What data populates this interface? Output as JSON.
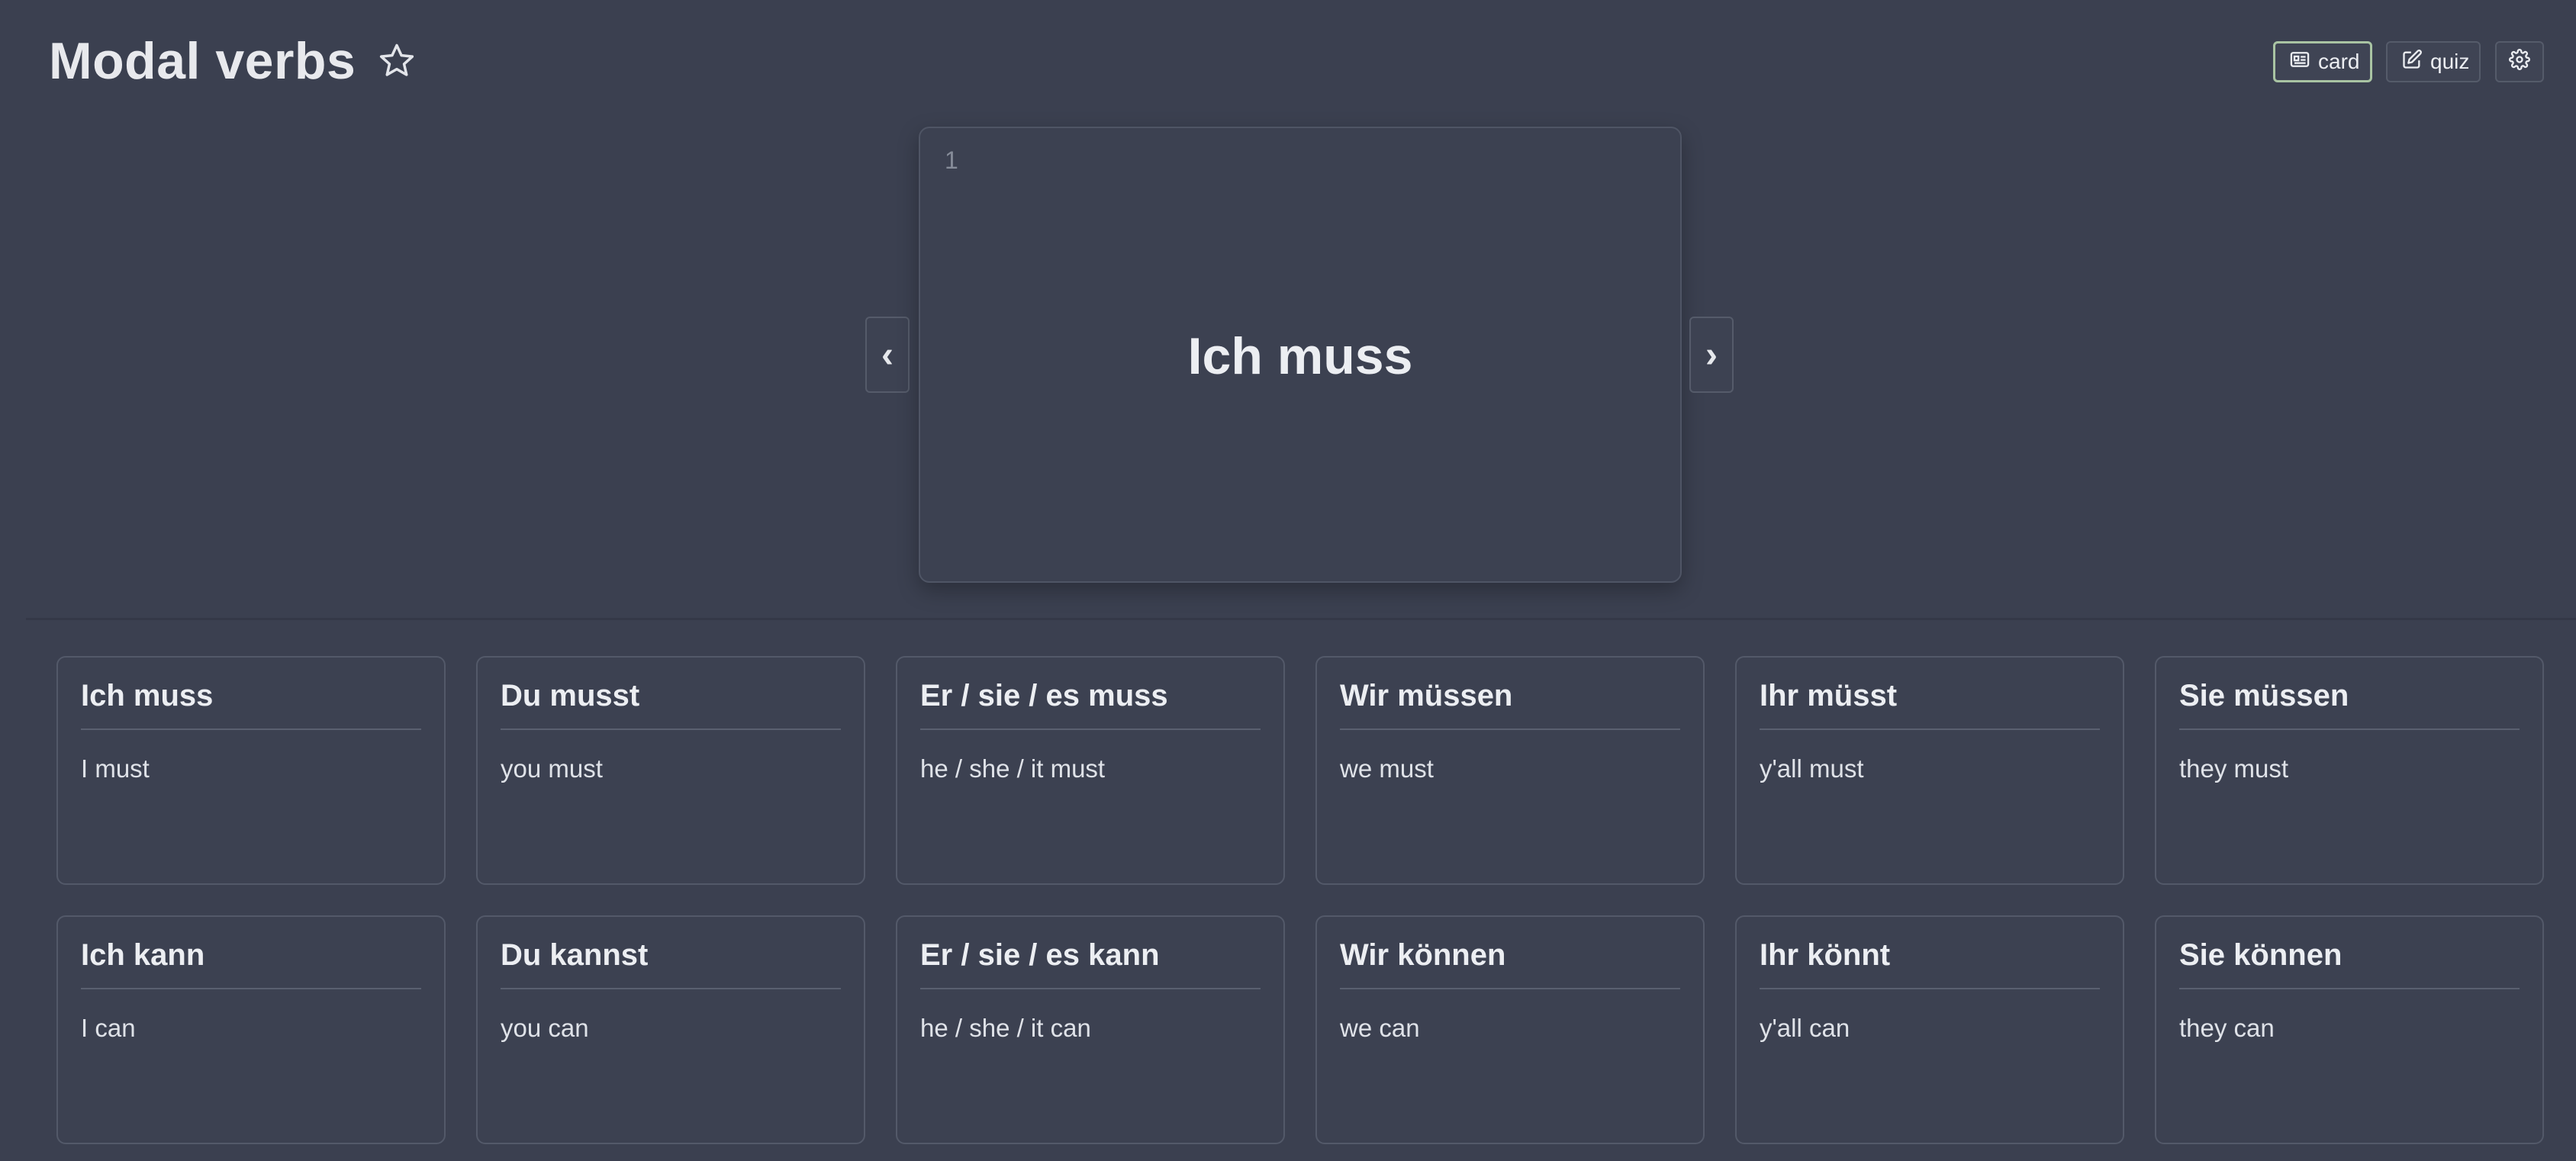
{
  "header": {
    "title": "Modal verbs",
    "favorite_icon": "star-outline-icon"
  },
  "toolbar": {
    "card_label": "card",
    "card_icon": "card-icon",
    "quiz_label": "quiz",
    "quiz_icon": "edit-icon",
    "settings_icon": "gear-icon",
    "active_mode": "card",
    "accent_color": "#a9c4a3"
  },
  "flashcard": {
    "index": "1",
    "front": "Ich muss",
    "prev_label": "‹",
    "next_label": "›"
  },
  "cards": [
    {
      "term": "Ich muss",
      "definition": "I must"
    },
    {
      "term": "Du musst",
      "definition": "you must"
    },
    {
      "term": "Er / sie / es muss",
      "definition": "he / she / it must"
    },
    {
      "term": "Wir müssen",
      "definition": "we must"
    },
    {
      "term": "Ihr müsst",
      "definition": "y'all must"
    },
    {
      "term": "Sie müssen",
      "definition": "they must"
    },
    {
      "term": "Ich kann",
      "definition": "I can"
    },
    {
      "term": "Du kannst",
      "definition": "you can"
    },
    {
      "term": "Er / sie / es kann",
      "definition": "he / she / it can"
    },
    {
      "term": "Wir können",
      "definition": "we can"
    },
    {
      "term": "Ihr könnt",
      "definition": "y'all can"
    },
    {
      "term": "Sie können",
      "definition": "they can"
    }
  ]
}
